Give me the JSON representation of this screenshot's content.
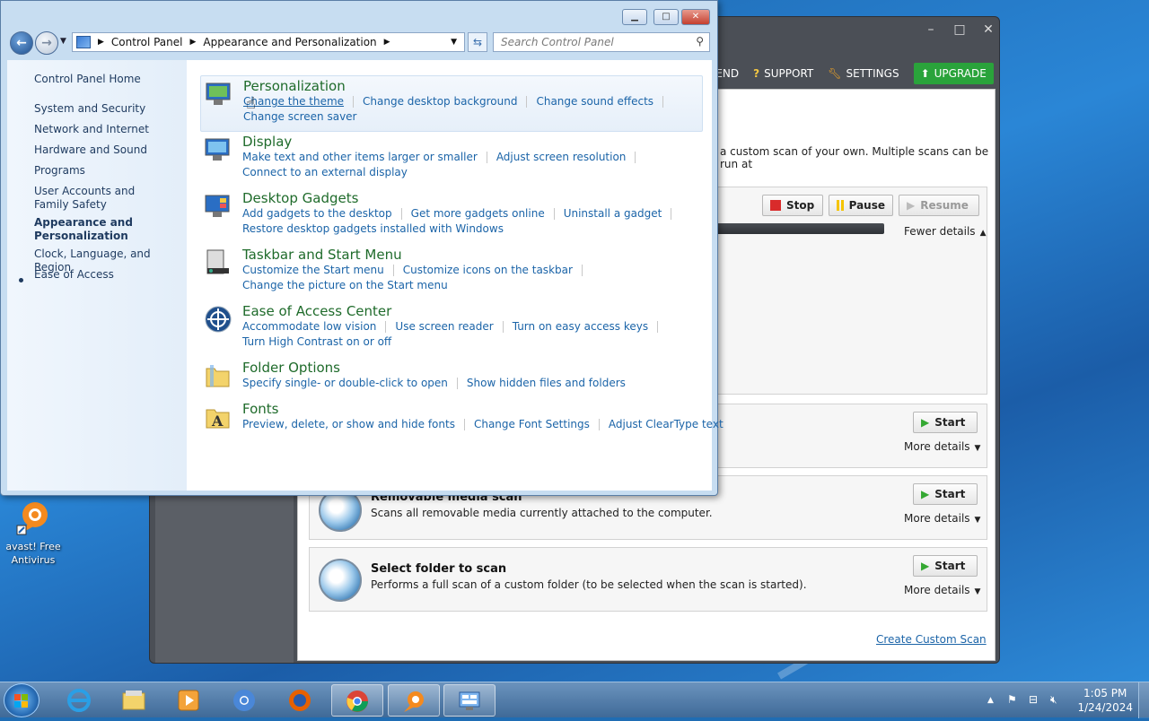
{
  "desktop": {
    "icon_label": "avast! Free Antivirus"
  },
  "avast": {
    "nav": {
      "recommend": "MEND",
      "support": "SUPPORT",
      "settings": "SETTINGS",
      "upgrade": "UPGRADE"
    },
    "intro_text": "a custom scan of your own. Multiple scans can be run at",
    "running_scan": {
      "stop": "Stop",
      "pause": "Pause",
      "resume": "Resume",
      "fewer_details": "Fewer details"
    },
    "scans": [
      {
        "title": "",
        "desc": "",
        "start": "Start",
        "more": "More details"
      },
      {
        "title": "Removable media scan",
        "desc": "Scans all removable media currently attached to the computer.",
        "start": "Start",
        "more": "More details"
      },
      {
        "title": "Select folder to scan",
        "desc": "Performs a full scan of a custom folder (to be selected when the scan is started).",
        "start": "Start",
        "more": "More details"
      }
    ],
    "create_custom": "Create Custom Scan"
  },
  "control_panel": {
    "breadcrumb": [
      "Control Panel",
      "Appearance and Personalization"
    ],
    "search_placeholder": "Search Control Panel",
    "sidebar": [
      "Control Panel Home",
      "System and Security",
      "Network and Internet",
      "Hardware and Sound",
      "Programs",
      "User Accounts and Family Safety",
      "Appearance and Personalization",
      "Clock, Language, and Region",
      "Ease of Access"
    ],
    "categories": [
      {
        "title": "Personalization",
        "links": [
          "Change the theme",
          "Change desktop background",
          "Change sound effects",
          "Change screen saver"
        ]
      },
      {
        "title": "Display",
        "links": [
          "Make text and other items larger or smaller",
          "Adjust screen resolution",
          "Connect to an external display"
        ]
      },
      {
        "title": "Desktop Gadgets",
        "links": [
          "Add gadgets to the desktop",
          "Get more gadgets online",
          "Uninstall a gadget",
          "Restore desktop gadgets installed with Windows"
        ]
      },
      {
        "title": "Taskbar and Start Menu",
        "links": [
          "Customize the Start menu",
          "Customize icons on the taskbar",
          "Change the picture on the Start menu"
        ]
      },
      {
        "title": "Ease of Access Center",
        "links": [
          "Accommodate low vision",
          "Use screen reader",
          "Turn on easy access keys",
          "Turn High Contrast on or off"
        ]
      },
      {
        "title": "Folder Options",
        "links": [
          "Specify single- or double-click to open",
          "Show hidden files and folders"
        ]
      },
      {
        "title": "Fonts",
        "links": [
          "Preview, delete, or show and hide fonts",
          "Change Font Settings",
          "Adjust ClearType text"
        ]
      }
    ]
  },
  "taskbar": {
    "time": "1:05 PM",
    "date": "1/24/2024"
  }
}
